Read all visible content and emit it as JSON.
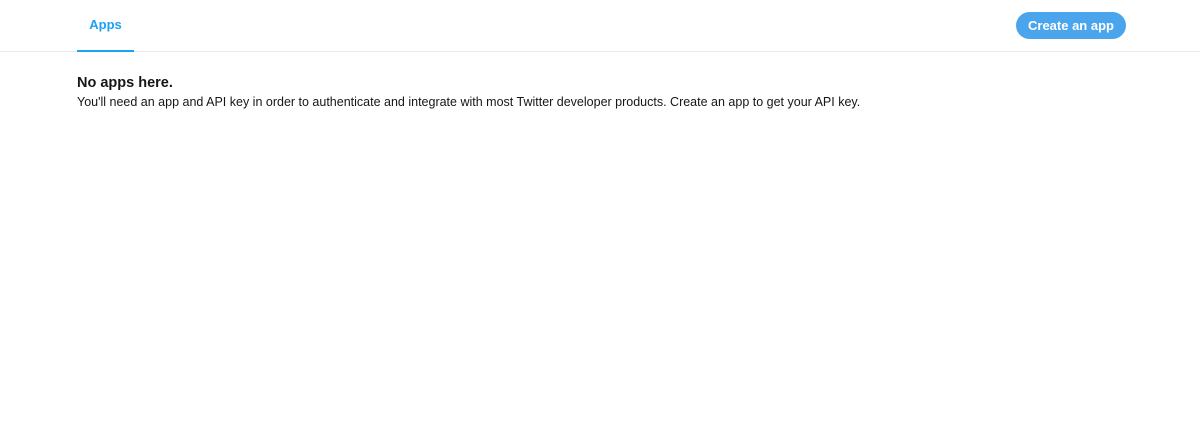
{
  "tabs": [
    {
      "label": "Apps",
      "active": true
    }
  ],
  "header": {
    "create_button_label": "Create an app"
  },
  "empty_state": {
    "title": "No apps here.",
    "message": "You'll need an app and API key in order to authenticate and integrate with most Twitter developer products. Create an app to get your API key."
  },
  "colors": {
    "accent": "#1da1f2",
    "button_bg": "#4aa5ec",
    "text": "#14171a",
    "divider": "#e6ecf0"
  }
}
